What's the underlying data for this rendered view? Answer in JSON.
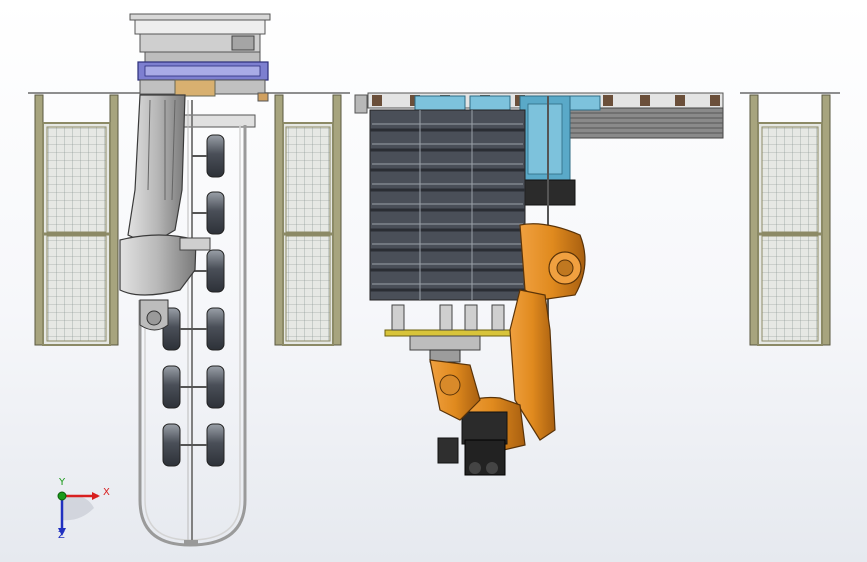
{
  "viewport": {
    "background_top": "#ffffff",
    "background_bottom": "#e6e9ef"
  },
  "colors": {
    "robot_orange": "#e08a1e",
    "robot_orange_dark": "#a85f10",
    "robot_gray": "#c8c8c8",
    "robot_gray_dark": "#7a7a7a",
    "tire_dark": "#4a4f58",
    "tire_light": "#8a9099",
    "fence_frame": "#8c8a66",
    "fence_mesh": "#7b8a86",
    "cyan_panel": "#5aa9c8",
    "conveyor_brown": "#6b4f3a",
    "axis_x": "#d82020",
    "axis_y": "#1a9a1a",
    "axis_z": "#2030c0"
  },
  "triad": {
    "x_label": "X",
    "y_label": "Y",
    "z_label": "Z"
  },
  "icons": [
    "coordinate-triad-icon"
  ]
}
